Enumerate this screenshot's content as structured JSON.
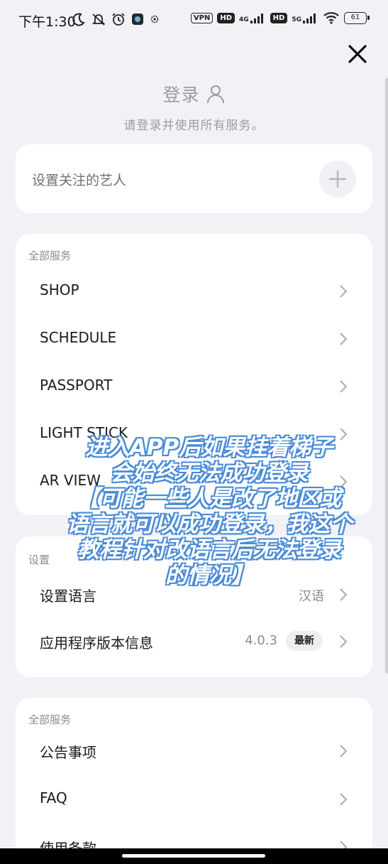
{
  "status_bar": {
    "time": "下午1:30",
    "icons_left": [
      "moon-icon",
      "bell-off-icon",
      "alarm-icon",
      "app-icon",
      "gear-icon"
    ],
    "vpn": "VPN",
    "hd1": "HD",
    "net1": "4G",
    "hd2": "HD",
    "net2": "5G",
    "battery": "61"
  },
  "header": {
    "title": "登录",
    "subtitle": "请登录并使用所有服务。"
  },
  "artist_card": {
    "label": "设置关注的艺人"
  },
  "services": {
    "section_title": "全部服务",
    "items": [
      {
        "label": "SHOP"
      },
      {
        "label": "SCHEDULE"
      },
      {
        "label": "PASSPORT"
      },
      {
        "label": "LIGHT STICK"
      },
      {
        "label": "AR VIEW"
      }
    ]
  },
  "settings": {
    "section_title": "设置",
    "language_label": "设置语言",
    "language_value": "汉语",
    "version_label": "应用程序版本信息",
    "version_value": "4.0.3",
    "version_badge": "最新"
  },
  "support": {
    "section_title": "全部服务",
    "items": [
      {
        "label": "公告事项"
      },
      {
        "label": "FAQ"
      },
      {
        "label": "使用条款"
      }
    ]
  },
  "caption": {
    "lines": [
      "进入APP后如果挂着梯子",
      "会始终无法成功登录",
      "【可能一些人是改了地区或",
      "语言就可以成功登录，我这个",
      "教程针对改语言后无法登录",
      "的情况】"
    ],
    "text_color": "#ffffff",
    "outline_color": "#4a8bd6"
  }
}
